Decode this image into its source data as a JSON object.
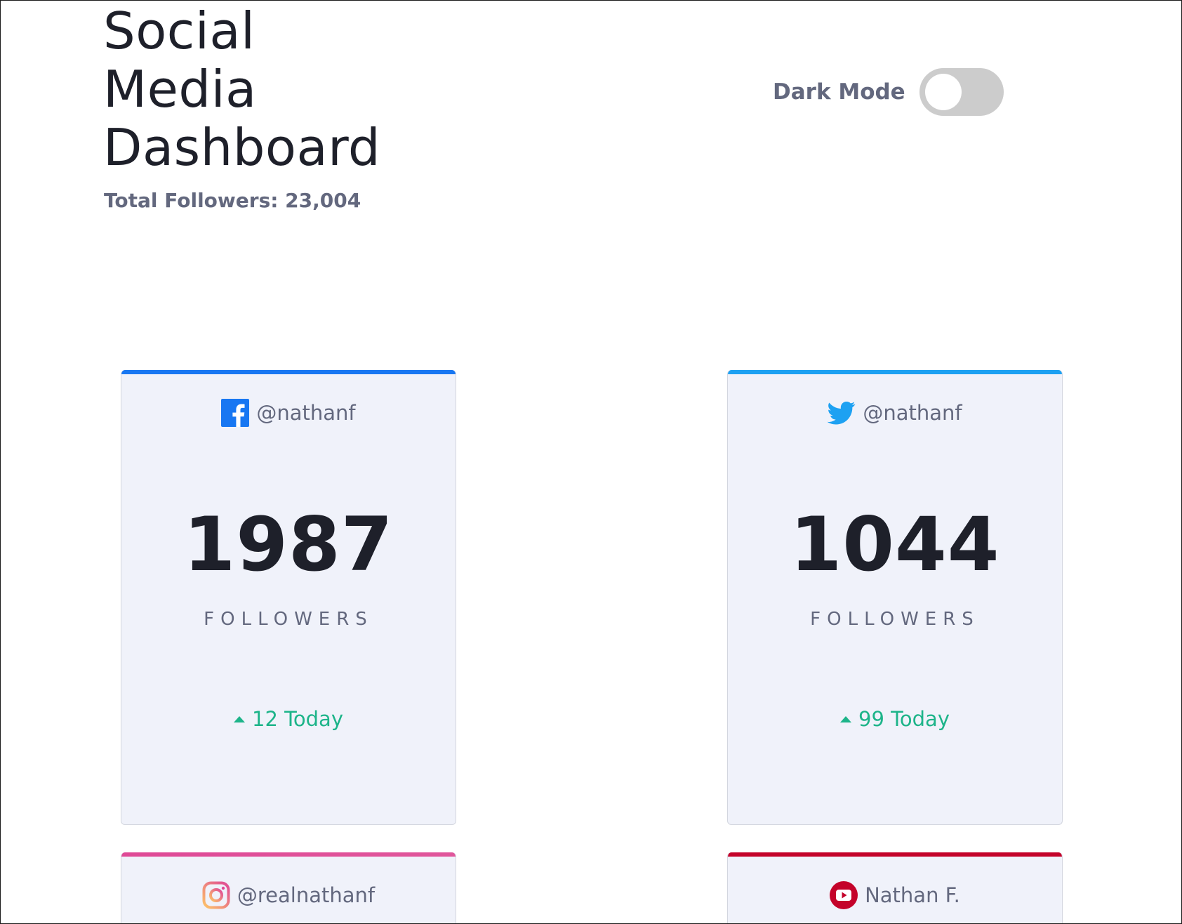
{
  "header": {
    "title": "Social Media Dashboard",
    "total_followers": "Total Followers: 23,004",
    "dark_mode_label": "Dark Mode",
    "dark_mode_on": false
  },
  "colors": {
    "facebook": "#1877f2",
    "twitter": "#1da1f2",
    "instagram_start": "#fdc468",
    "instagram_end": "#df4996",
    "youtube": "#c4032a",
    "positive": "#1db489",
    "card_bg": "#f0f2fa"
  },
  "cards": [
    {
      "platform": "facebook",
      "icon": "facebook-icon",
      "handle": "@nathanf",
      "count": "1987",
      "label": "FOLLOWERS",
      "today": "12 Today",
      "trend": "up"
    },
    {
      "platform": "twitter",
      "icon": "twitter-icon",
      "handle": "@nathanf",
      "count": "1044",
      "label": "FOLLOWERS",
      "today": "99 Today",
      "trend": "up"
    },
    {
      "platform": "instagram",
      "icon": "instagram-icon",
      "handle": "@realnathanf"
    },
    {
      "platform": "youtube",
      "icon": "youtube-icon",
      "handle": "Nathan F."
    }
  ]
}
